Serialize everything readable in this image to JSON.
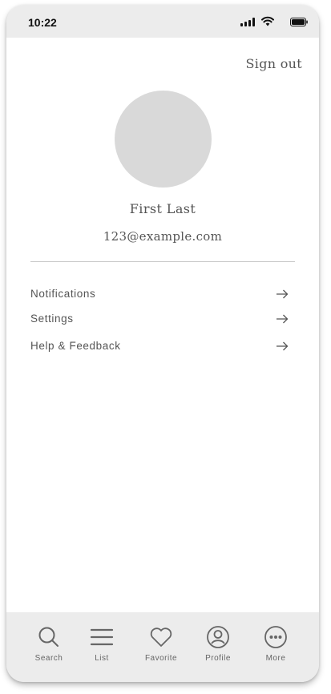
{
  "status_bar": {
    "time": "10:22"
  },
  "header": {
    "sign_out": "Sign out"
  },
  "profile": {
    "name": "First Last",
    "email": "123@example.com"
  },
  "menu": [
    {
      "label": "Notifications",
      "icon": "arrow-right-icon"
    },
    {
      "label": "Settings",
      "icon": "arrow-right-icon"
    },
    {
      "label": "Help & Feedback",
      "icon": "arrow-right-icon"
    }
  ],
  "tabs": [
    {
      "label": "Search",
      "icon": "search-icon"
    },
    {
      "label": "List",
      "icon": "list-icon"
    },
    {
      "label": "Favorite",
      "icon": "heart-icon"
    },
    {
      "label": "Profile",
      "icon": "profile-icon"
    },
    {
      "label": "More",
      "icon": "more-icon"
    }
  ],
  "colors": {
    "status_bar_bg": "#ececec",
    "tab_bar_bg": "#ececec",
    "avatar": "#d9d9d9",
    "text": "#555555"
  }
}
